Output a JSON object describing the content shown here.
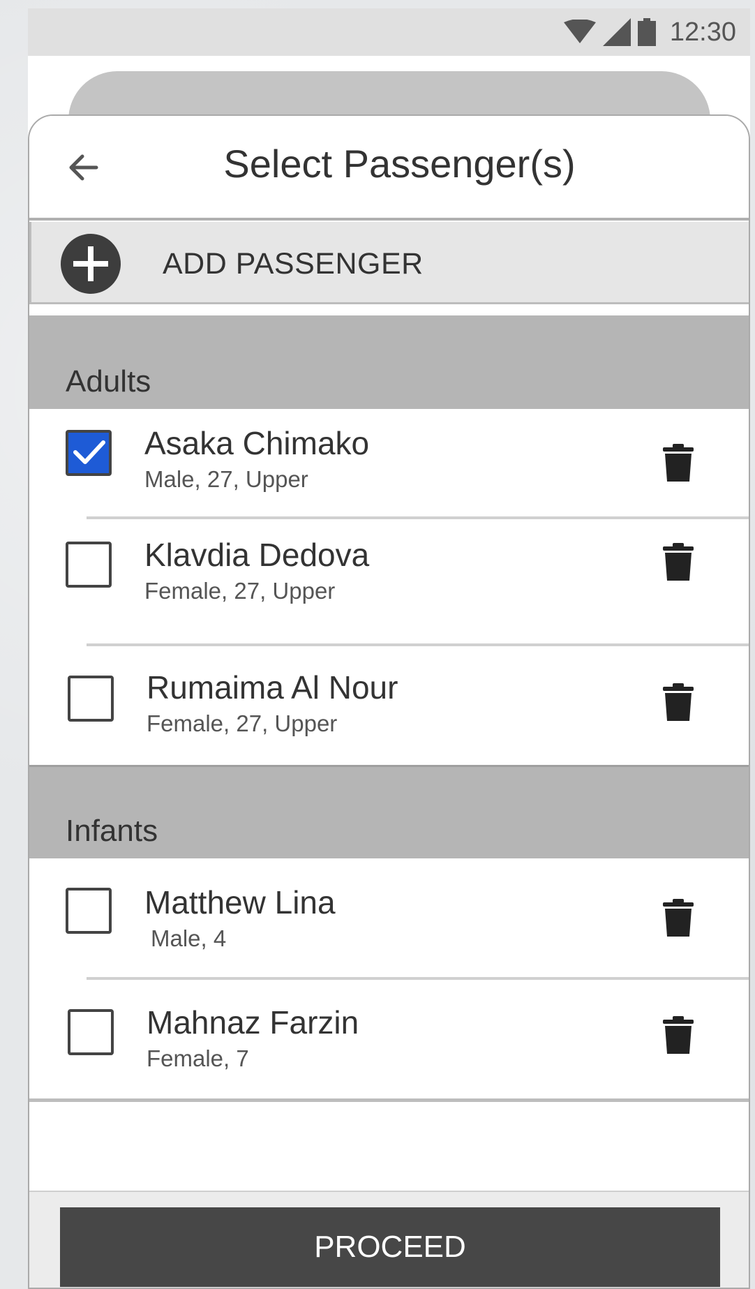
{
  "status_bar": {
    "time": "12:30",
    "icons": [
      "wifi-icon",
      "signal-icon",
      "battery-icon"
    ]
  },
  "header": {
    "title": "Select Passenger(s)",
    "back_icon": "arrow-left-icon"
  },
  "add_passenger": {
    "label": "ADD PASSENGER",
    "icon": "plus-circle-icon"
  },
  "sections": [
    {
      "label": "Adults",
      "passengers": [
        {
          "name": "Asaka Chimako",
          "detail": "Male, 27, Upper",
          "checked": true
        },
        {
          "name": "Klavdia Dedova",
          "detail": "Female, 27, Upper",
          "checked": false
        },
        {
          "name": "Rumaima Al Nour",
          "detail": "Female, 27, Upper",
          "checked": false
        }
      ]
    },
    {
      "label": "Infants",
      "passengers": [
        {
          "name": "Matthew Lina",
          "detail": "Male, 4",
          "checked": false
        },
        {
          "name": "Mahnaz Farzin",
          "detail": "Female, 7",
          "checked": false
        }
      ]
    }
  ],
  "footer": {
    "proceed_label": "PROCEED"
  },
  "colors": {
    "accent": "#1e5bd6",
    "button": "#474747",
    "section_bg": "#b5b5b5"
  }
}
